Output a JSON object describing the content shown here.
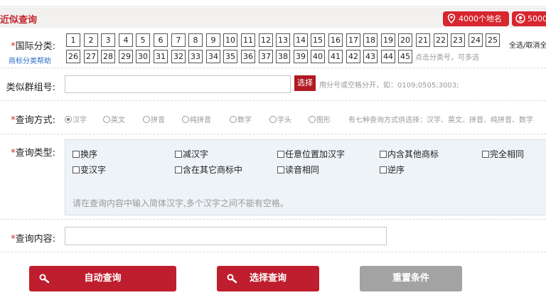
{
  "header": {
    "title": "近似查询",
    "places_badge": "4000个地名",
    "second_badge": "5000"
  },
  "class_section": {
    "label": "国际分类:",
    "help_link": "商标分类帮助",
    "numbers_row1": [
      "1",
      "2",
      "3",
      "4",
      "5",
      "6",
      "7",
      "8",
      "9",
      "10",
      "11",
      "12",
      "13",
      "14",
      "15",
      "16",
      "17",
      "18",
      "19",
      "20",
      "21",
      "22",
      "23",
      "24",
      "25"
    ],
    "numbers_row2": [
      "26",
      "27",
      "28",
      "29",
      "30",
      "31",
      "32",
      "33",
      "34",
      "35",
      "36",
      "37",
      "38",
      "39",
      "40",
      "41",
      "42",
      "43",
      "44",
      "45"
    ],
    "select_all": "全选/取消全",
    "hint": "点击分类号，可多选"
  },
  "group_section": {
    "label": "类似群组号:",
    "value": "",
    "select_button": "选择",
    "hint": "用分号或空格分开，如：0109;0505;3003;"
  },
  "method_section": {
    "label": "查询方式:",
    "options": [
      "汉字",
      "英文",
      "拼音",
      "纯拼音",
      "数字",
      "字头",
      "图形"
    ],
    "selected": "汉字",
    "hint": "有七种查询方式供选择：汉字、英文、拼音、纯拼音、数字"
  },
  "type_section": {
    "label": "查询类型:",
    "options_row1": [
      "换序",
      "减汉字",
      "任意位置加汉字",
      "内含其他商标",
      "完全相同"
    ],
    "options_row2": [
      "变汉字",
      "含在其它商标中",
      "读音相同",
      "逆序"
    ],
    "hint": "请在查询内容中输入简体汉字,多个汉字之间不能有空格。"
  },
  "content_section": {
    "label": "查询内容:",
    "value": ""
  },
  "actions": {
    "auto_query": "自动查询",
    "select_query": "选择查询",
    "reset": "重置条件"
  },
  "colors": {
    "brand_red": "#c1272d",
    "button_red": "#be1e2d",
    "button_gray": "#a3a3a3"
  }
}
